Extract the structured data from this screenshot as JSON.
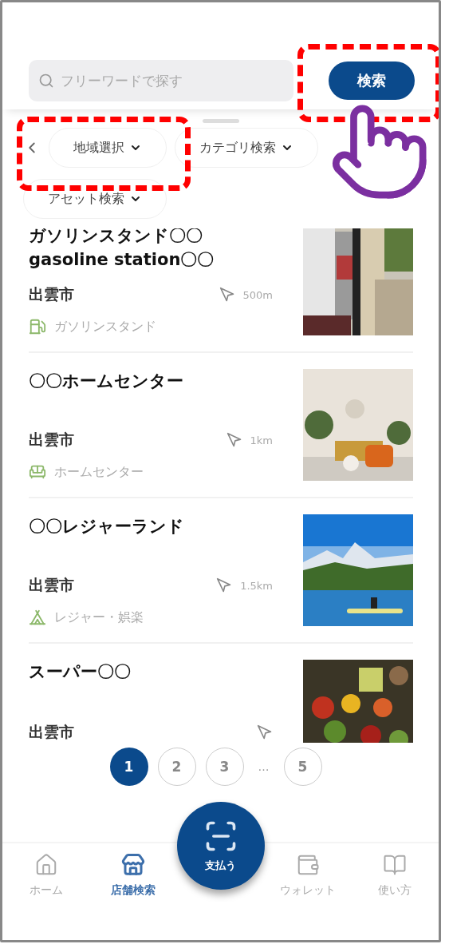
{
  "search": {
    "placeholder": "フリーワードで探す",
    "button": "検索"
  },
  "filters": [
    {
      "label": "地域選択"
    },
    {
      "label": "カテゴリ検索"
    },
    {
      "label": "アセット検索"
    }
  ],
  "stores": [
    {
      "name": "ガソリンスタンド〇〇\ngasoline station〇〇",
      "city": "出雲市",
      "distance": "500m",
      "category": "ガソリンスタンド",
      "kind": "fuel"
    },
    {
      "name": "〇〇ホームセンター",
      "city": "出雲市",
      "distance": "1km",
      "category": "ホームセンター",
      "kind": "sofa"
    },
    {
      "name": "〇〇レジャーランド",
      "city": "出雲市",
      "distance": "1.5km",
      "category": "レジャー・娯楽",
      "kind": "tent"
    },
    {
      "name": "スーパー〇〇",
      "city": "出雲市"
    }
  ],
  "pagination": [
    {
      "label": "1",
      "selected": true
    },
    {
      "label": "2",
      "selected": false
    },
    {
      "label": "3",
      "selected": false
    },
    {
      "kind": "gap",
      "label": "…"
    },
    {
      "label": "5",
      "selected": false
    }
  ],
  "pay_button": "支払う",
  "nav": [
    {
      "label": "ホーム",
      "selected": false
    },
    {
      "label": "店舗検索",
      "selected": true
    },
    {
      "label": "ウォレット",
      "selected": false
    },
    {
      "label": "使い方",
      "selected": false
    }
  ]
}
